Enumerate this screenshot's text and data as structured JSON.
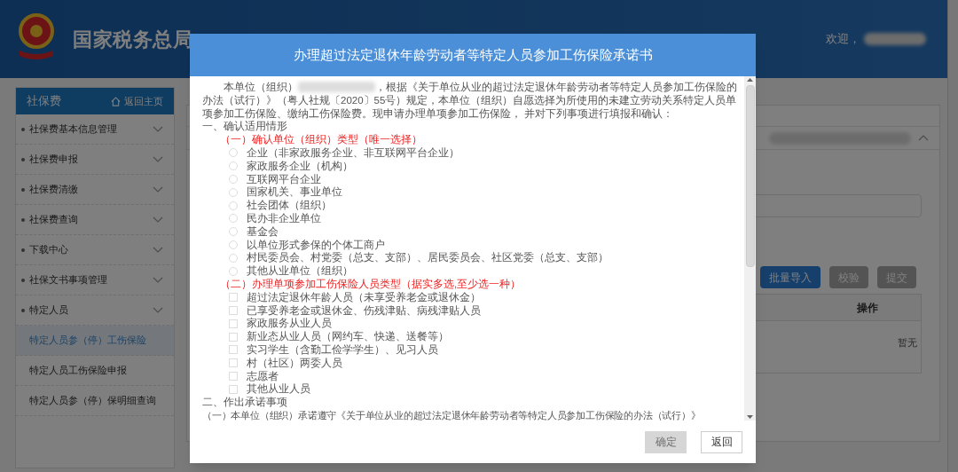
{
  "header": {
    "title": "国家税务总局",
    "welcome": "欢迎，"
  },
  "sidebar": {
    "title": "社保费",
    "home_link": "返回主页",
    "items": [
      {
        "label": "社保费基本信息管理",
        "kind": "group",
        "selected": false
      },
      {
        "label": "社保费申报",
        "kind": "group",
        "selected": false
      },
      {
        "label": "社保费清缴",
        "kind": "group",
        "selected": false
      },
      {
        "label": "社保费查询",
        "kind": "group",
        "selected": false
      },
      {
        "label": "下载中心",
        "kind": "group",
        "selected": false
      },
      {
        "label": "社保文书事项管理",
        "kind": "group",
        "selected": false
      },
      {
        "label": "特定人员",
        "kind": "group",
        "selected": false
      },
      {
        "label": "特定人员参（停）工伤保险",
        "kind": "sub",
        "selected": true
      },
      {
        "label": "特定人员工伤保险申报",
        "kind": "sub",
        "selected": false
      },
      {
        "label": "特定人员参（停）保明细查询",
        "kind": "sub",
        "selected": false
      }
    ]
  },
  "main": {
    "buttons": [
      {
        "label": "批量导入",
        "disabled": false
      },
      {
        "label": "校验",
        "disabled": true
      },
      {
        "label": "提交",
        "disabled": true
      }
    ],
    "table": {
      "columns": [
        "操作"
      ],
      "empty_text": "暂无"
    }
  },
  "dialog": {
    "title": "办理超过法定退休年龄劳动者等特定人员参加工伤保险承诺书",
    "intro_start": "本单位（组织）",
    "intro_line_1": "，根据《关于单位从业的超过法定退休年龄劳动者等特定人员参加工伤保险的",
    "intro_rest": "办法（试行）》（粤人社规〔2020〕55号）规定，本单位（组织）自愿选择为所使用的未建立劳动关系特定人员单项参加工伤保险、缴纳工伤保险费。现申请办理单项参加工伤保险， 并对下列事项进行填报和确认：",
    "section_1": "一、确认适用情形",
    "groups": [
      {
        "heading": "（一）确认单位（组织）类型（唯一选择）",
        "kind": "radio",
        "options": [
          {
            "label": "企业（非家政服务企业、非互联网平台企业）",
            "checked": false
          },
          {
            "label": "家政服务企业（机构）",
            "checked": false
          },
          {
            "label": "互联网平台企业",
            "checked": false
          },
          {
            "label": "国家机关、事业单位",
            "checked": false
          },
          {
            "label": "社会团体（组织）",
            "checked": false
          },
          {
            "label": "民办非企业单位",
            "checked": false
          },
          {
            "label": "基金会",
            "checked": false
          },
          {
            "label": "以单位形式参保的个体工商户",
            "checked": false
          },
          {
            "label": "村民委员会、村党委（总支、支部）、居民委员会、社区党委（总支、支部）",
            "checked": false
          },
          {
            "label": "其他从业单位（组织）",
            "checked": false
          }
        ]
      },
      {
        "heading": "（二）办理单项参加工伤保险人员类型（据实多选,至少选一种）",
        "kind": "checkbox",
        "options": [
          {
            "label": "超过法定退休年龄人员（未享受养老金或退休金）",
            "checked": false
          },
          {
            "label": "已享受养老金或退休金、伤残津贴、病残津贴人员",
            "checked": false
          },
          {
            "label": "家政服务从业人员",
            "checked": false
          },
          {
            "label": "新业态从业人员（网约车、快递、送餐等）",
            "checked": false
          },
          {
            "label": "实习学生（含勤工俭学学生）、见习人员",
            "checked": false
          },
          {
            "label": "村（社区）两委人员",
            "checked": false
          },
          {
            "label": "志愿者",
            "checked": false
          },
          {
            "label": "其他从业人员",
            "checked": false
          }
        ]
      }
    ],
    "section_2": "二、作出承诺事项",
    "pledge_1": "（一）本单位（组织）承诺遵守《关于单位从业的超过法定退休年龄劳动者等特定人员参加工伤保险的办法（试行）》",
    "buttons": [
      {
        "label": "确定",
        "disabled": true
      },
      {
        "label": "返回",
        "disabled": false
      }
    ]
  }
}
